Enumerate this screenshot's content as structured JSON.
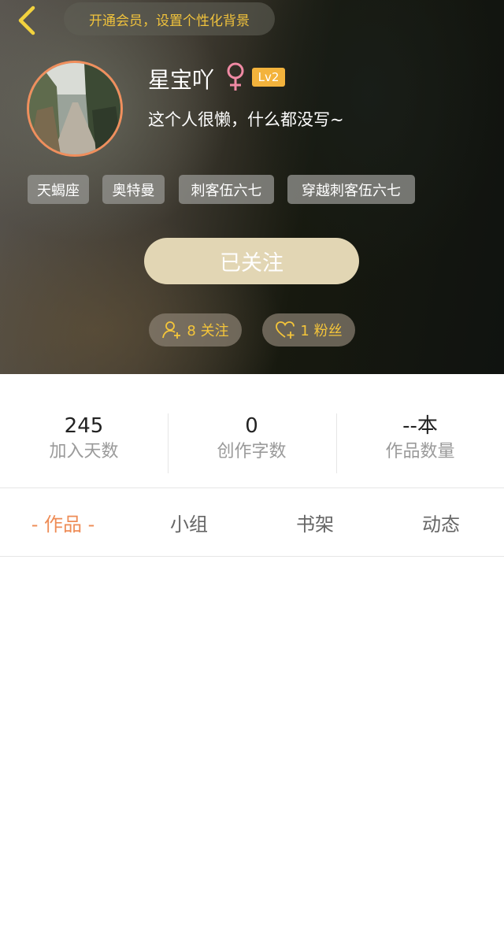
{
  "header": {
    "vip_banner": "开通会员，设置个性化背景",
    "username": "星宝吖",
    "level": "Lv2",
    "bio": "这个人很懒，什么都没写~",
    "tags": [
      "天蝎座",
      "奥特曼",
      "刺客伍六七",
      "穿越刺客伍六七"
    ],
    "follow_button": "已关注",
    "following": "8 关注",
    "fans": "1 粉丝"
  },
  "stats": [
    {
      "value": "245",
      "label": "加入天数"
    },
    {
      "value": "0",
      "label": "创作字数"
    },
    {
      "value": "--本",
      "label": "作品数量"
    }
  ],
  "tabs": [
    "- 作品 -",
    "小组",
    "书架",
    "动态"
  ],
  "colors": {
    "accent": "#ee8c56",
    "vip_text": "#f0c23c",
    "level_badge": "#f3b33c",
    "follow_button": "#e2d6b4",
    "female_icon": "#f08aa4"
  },
  "icons": {
    "back": "chevron-left-icon",
    "gender": "female-icon",
    "following": "user-plus-icon",
    "fans": "heart-plus-icon"
  }
}
